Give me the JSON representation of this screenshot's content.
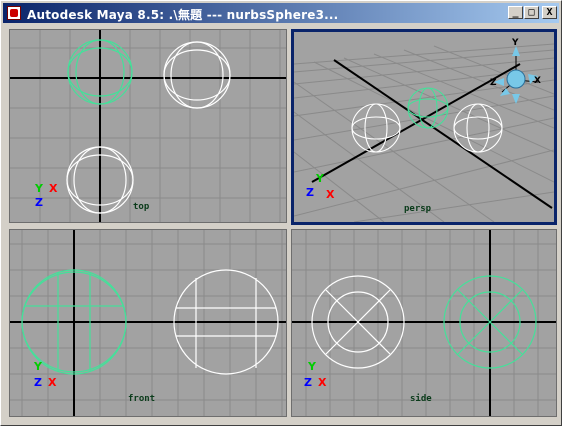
{
  "window": {
    "title": "Autodesk Maya 8.5: .\\無題    ---    nurbsSphere3...",
    "buttons": {
      "minimize": "_",
      "maximize": "□",
      "close": "X"
    }
  },
  "viewports": {
    "top": {
      "label": "top",
      "axes": [
        "Y",
        "X",
        "Z"
      ]
    },
    "persp": {
      "label": "persp",
      "axes": [
        "Y",
        "Z",
        "X"
      ]
    },
    "front": {
      "label": "front",
      "axes": [
        "Y",
        "Z",
        "X"
      ]
    },
    "side": {
      "label": "side",
      "axes": [
        "Y",
        "Z",
        "X"
      ]
    }
  },
  "view_cube": {
    "y": "Y",
    "x": "X",
    "z": "Z"
  },
  "colors": {
    "title_start": "#0a246a",
    "title_end": "#a6caf0",
    "viewport_bg": "#a2a2a2",
    "grid": "#8a8a8a",
    "selected_wire": "#45e09a",
    "unselected_wire": "#ffffff",
    "axis_x": "#ff0000",
    "axis_y": "#00cc00",
    "axis_z": "#0000ff"
  }
}
